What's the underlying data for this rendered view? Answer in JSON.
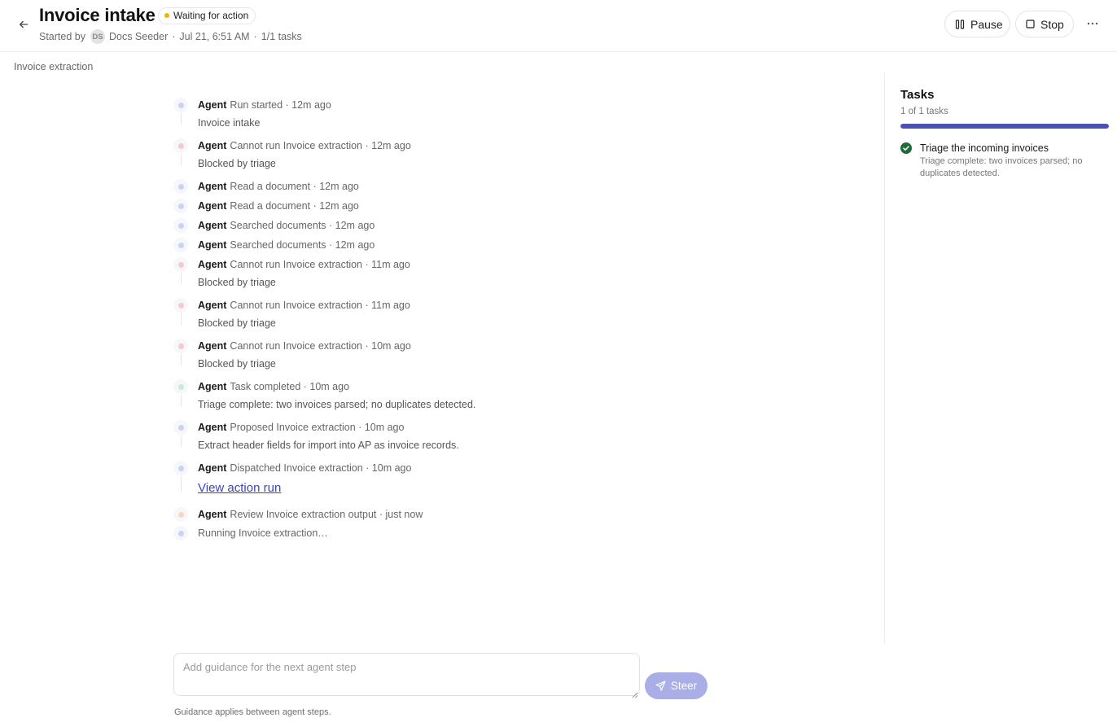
{
  "header": {
    "title": "Invoice intake",
    "status": "Waiting for action",
    "status_color": "#f0b400",
    "started_by_label": "Started by",
    "avatar_initials": "DS",
    "user_name": "Docs Seeder",
    "date": "Jul 21, 6:51 AM",
    "tasks_summary": "1/1 tasks",
    "pause_label": "Pause",
    "stop_label": "Stop"
  },
  "subheader": {
    "breadcrumb": "Invoice extraction"
  },
  "timeline": [
    {
      "actor": "Agent",
      "text": "Run started · 12m ago",
      "detail": "Invoice intake",
      "dot": "#c9d3f3",
      "line": true
    },
    {
      "actor": "Agent",
      "text": "Cannot run Invoice extraction · 12m ago",
      "detail": "Blocked by triage",
      "dot": "#f6caca",
      "line": true
    },
    {
      "actor": "Agent",
      "text": "Read a document · 12m ago",
      "detail": "",
      "dot": "#c9d3f3",
      "line": false
    },
    {
      "actor": "Agent",
      "text": "Read a document · 12m ago",
      "detail": "",
      "dot": "#c9d3f3",
      "line": false
    },
    {
      "actor": "Agent",
      "text": "Searched documents · 12m ago",
      "detail": "",
      "dot": "#c9d3f3",
      "line": false
    },
    {
      "actor": "Agent",
      "text": "Searched documents · 12m ago",
      "detail": "",
      "dot": "#c9d3f3",
      "line": false
    },
    {
      "actor": "Agent",
      "text": "Cannot run Invoice extraction · 11m ago",
      "detail": "Blocked by triage",
      "dot": "#f6caca",
      "line": true
    },
    {
      "actor": "Agent",
      "text": "Cannot run Invoice extraction · 11m ago",
      "detail": "Blocked by triage",
      "dot": "#f6caca",
      "line": true
    },
    {
      "actor": "Agent",
      "text": "Cannot run Invoice extraction · 10m ago",
      "detail": "Blocked by triage",
      "dot": "#f6caca",
      "line": true
    },
    {
      "actor": "Agent",
      "text": "Task completed · 10m ago",
      "detail": "Triage complete: two invoices parsed; no duplicates detected.",
      "dot": "#c6ecd1",
      "line": true
    },
    {
      "actor": "Agent",
      "text": "Proposed Invoice extraction · 10m ago",
      "detail": "Extract header fields for import into AP as invoice records.",
      "dot": "#c9d3f3",
      "line": true
    },
    {
      "actor": "Agent",
      "text": "Dispatched Invoice extraction · 10m ago",
      "link": "View action run",
      "dot": "#c9d3f3",
      "line": true
    },
    {
      "actor": "Agent",
      "text": "Review Invoice extraction output · just now",
      "detail": "",
      "dot": "#f8d6c0",
      "line": false
    },
    {
      "actor": "",
      "text": "Running Invoice extraction…",
      "detail": "",
      "dot": "#c9d3f3",
      "line": false
    }
  ],
  "tasks_panel": {
    "title": "Tasks",
    "count_label": "1 of 1 tasks",
    "progress": 1.0,
    "progress_color": "#4b51b0",
    "items": [
      {
        "title": "Triage the incoming invoices",
        "description": "Triage complete: two invoices parsed; no duplicates detected.",
        "status": "done",
        "icon": "check-circle-icon"
      }
    ]
  },
  "steer": {
    "placeholder": "Add guidance for the next agent step",
    "button_label": "Steer",
    "hint": "Guidance applies between agent steps."
  }
}
